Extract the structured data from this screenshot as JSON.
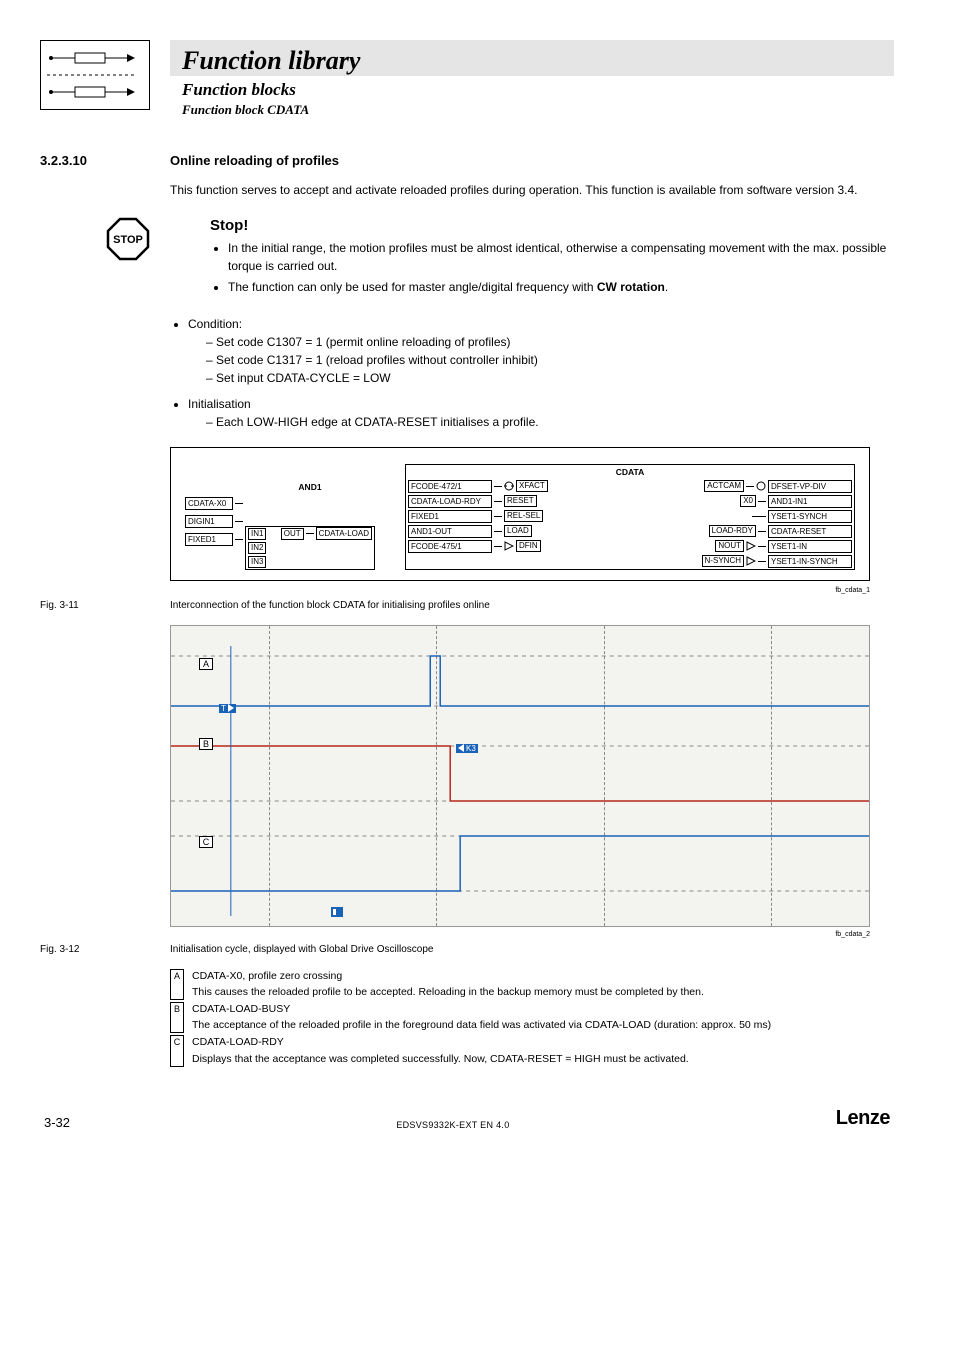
{
  "header": {
    "title": "Function library",
    "subtitle1": "Function blocks",
    "subtitle2": "Function block CDATA"
  },
  "section": {
    "number": "3.2.3.10",
    "title": "Online reloading of profiles",
    "intro": "This function serves to accept and activate reloaded profiles during operation. This function is available from software version 3.4."
  },
  "stop": {
    "label": "Stop!",
    "bullets": [
      "In the initial range, the motion profiles must be almost identical, otherwise a compensating movement with the max. possible torque is carried out.",
      {
        "pre": "The function can only be used for master angle/digital frequency with ",
        "bold": "CW rotation",
        "post": "."
      }
    ]
  },
  "conditions": {
    "title": "Condition:",
    "items": [
      "Set code C1307 = 1 (permit online reloading of profiles)",
      "Set code C1317 = 1 (reload profiles without controller inhibit)",
      "Set input CDATA-CYCLE = LOW"
    ]
  },
  "init": {
    "title": "Initialisation",
    "items": [
      "Each LOW-HIGH edge at CDATA-RESET initialises a profile."
    ]
  },
  "diagram": {
    "and": {
      "title": "AND1",
      "in": [
        "IN1",
        "IN2",
        "IN3"
      ],
      "out": "OUT",
      "left_inputs": [
        "CDATA-X0",
        "DIGIN1",
        "FIXED1"
      ],
      "output_target": "CDATA-LOAD"
    },
    "cdata": {
      "title": "CDATA",
      "left": [
        {
          "src": "FCODE-472/1",
          "pin": "XFACT"
        },
        {
          "src": "CDATA-LOAD-RDY",
          "pin": "RESET"
        },
        {
          "src": "FIXED1",
          "pin": "REL-SEL"
        },
        {
          "src": "AND1-OUT",
          "pin": "LOAD"
        },
        {
          "src": "FCODE-475/1",
          "pin": "DFIN"
        }
      ],
      "right": [
        {
          "pin": "ACTCAM",
          "dst": "DFSET-VP-DIV"
        },
        {
          "pin": "X0",
          "dst": "AND1-IN1"
        },
        {
          "pin": "",
          "dst": "YSET1-SYNCH"
        },
        {
          "pin": "LOAD-RDY",
          "dst": "CDATA-RESET"
        },
        {
          "pin": "NOUT",
          "dst": "YSET1-IN"
        },
        {
          "pin": "N-SYNCH",
          "dst": "YSET1-IN-SYNCH"
        }
      ]
    },
    "file_label": "fb_cdata_1"
  },
  "fig11": {
    "num": "Fig. 3-11",
    "cap": "Interconnection of the function block CDATA for initialising profiles online"
  },
  "scope_file": "fb_cdata_2",
  "fig12": {
    "num": "Fig. 3-12",
    "cap": "Initialisation cycle, displayed with Global Drive Oscilloscope"
  },
  "legend": {
    "A": {
      "title": "CDATA-X0, profile zero crossing",
      "desc": "This causes the reloaded profile to be accepted. Reloading in the backup memory must be completed by then."
    },
    "B": {
      "title": "CDATA-LOAD-BUSY",
      "desc": "The acceptance of the reloaded profile in the foreground data field was activated via CDATA-LOAD (duration: approx. 50 ms)"
    },
    "C": {
      "title": "CDATA-LOAD-RDY",
      "desc": "Displays that the acceptance was completed successfully. Now, CDATA-RESET = HIGH must be activated."
    }
  },
  "chart_data": {
    "type": "line",
    "title": "Initialisation cycle (Global Drive Oscilloscope)",
    "x": {
      "unit": "time",
      "ticks_visible": 4,
      "range_approx": "4 grid divisions"
    },
    "tracks": [
      {
        "id": "A",
        "name": "CDATA-X0",
        "color": "#1a62b8",
        "shape": "flat LOW with a single narrow HIGH pulse at the 2nd vertical gridline",
        "levels": {
          "low": 0,
          "high": 1
        }
      },
      {
        "id": "B",
        "name": "CDATA-LOAD-BUSY",
        "color": "#b8281a",
        "shape": "HIGH from start; drops to LOW slightly after the 2nd gridline; stays LOW",
        "falling_edge_at_grid": 2.1,
        "levels": {
          "low": 0,
          "high": 1
        }
      },
      {
        "id": "C",
        "name": "CDATA-LOAD-RDY",
        "color": "#1a62b8",
        "shape": "LOW from start; steps HIGH shortly after B falls; stays HIGH",
        "rising_edge_at_grid": 2.15,
        "levels": {
          "low": 0,
          "high": 1
        }
      }
    ],
    "cursors": [
      {
        "label": "T",
        "type": "vertical",
        "at_grid": 0.4,
        "color": "#1a62b8"
      },
      {
        "label": "K3",
        "type": "vertical",
        "at_grid": 2.1,
        "color": "#1a62b8"
      }
    ]
  },
  "footer": {
    "page": "3-32",
    "doc": "EDSVS9332K-EXT EN 4.0",
    "brand": "Lenze"
  }
}
